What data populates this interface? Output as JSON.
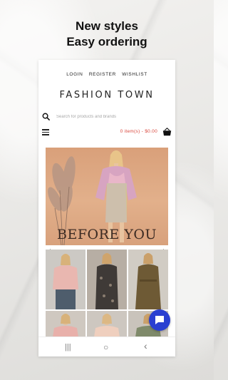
{
  "promo": {
    "line1": "New styles",
    "line2": "Easy ordering"
  },
  "topnav": {
    "login": "LOGIN",
    "register": "REGISTER",
    "wishlist": "WISHLIST"
  },
  "brand": "FASHION TOWN",
  "search": {
    "placeholder": "Search for products and brands",
    "icon": "search-icon"
  },
  "cart": {
    "summary": "0 item(s) - $0.00",
    "icon": "shopping-basket-icon"
  },
  "hero": {
    "caption": "BEFORE YOU"
  },
  "carousel": {
    "prev": "‹",
    "next": "›"
  },
  "system_nav": {
    "recent": "|||",
    "home": "○",
    "back": "‹"
  },
  "colors": {
    "accent_red": "#d9453b",
    "chat_blue": "#2a3fd1",
    "hero_bg": "#d9a07a"
  }
}
